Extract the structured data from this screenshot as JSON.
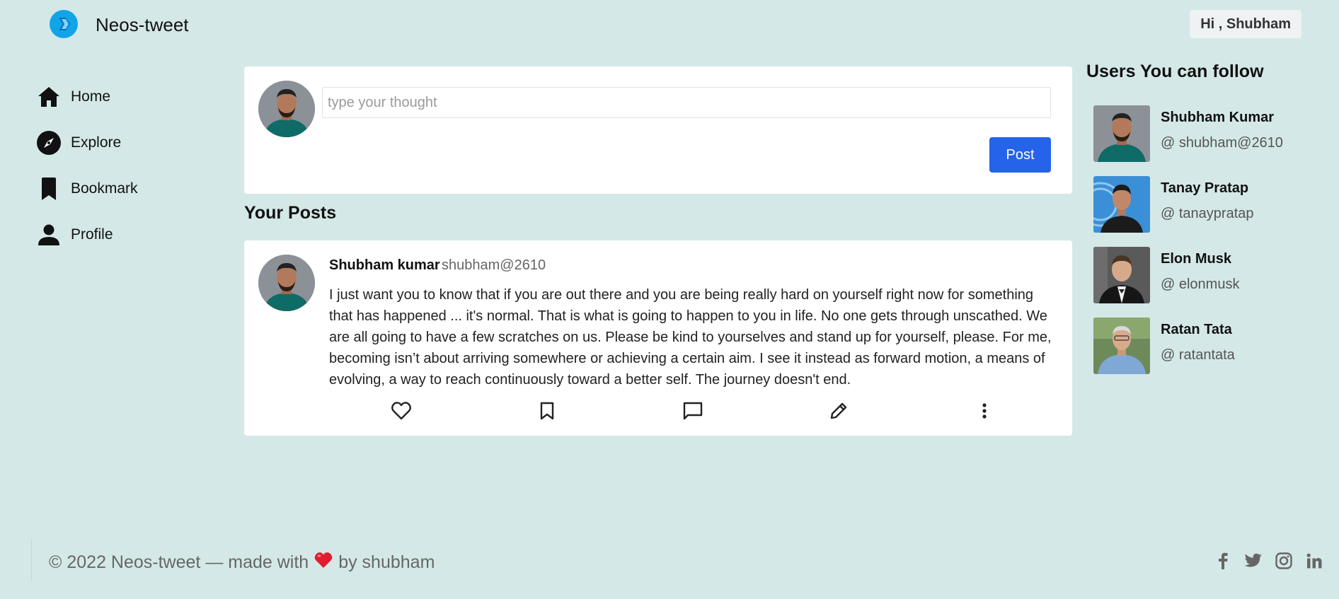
{
  "header": {
    "brand": "Neos-tweet",
    "greeting": "Hi , Shubham",
    "logo_icon": "arrow-chevron-logo-icon",
    "accent_color": "#11a4e8"
  },
  "sidebar": {
    "items": [
      {
        "label": "Home",
        "icon": "home-icon"
      },
      {
        "label": "Explore",
        "icon": "compass-icon"
      },
      {
        "label": "Bookmark",
        "icon": "bookmark-icon"
      },
      {
        "label": "Profile",
        "icon": "user-icon"
      }
    ]
  },
  "composer": {
    "placeholder": "type your thought",
    "value": "",
    "post_label": "Post",
    "post_color": "#2563eb"
  },
  "posts_section": {
    "title": "Your Posts",
    "posts": [
      {
        "name": "Shubham kumar",
        "handle": "shubham@2610",
        "body": "I just want you to know that if you are out there and you are being really hard on yourself right now for something that has happened ... it's normal. That is what is going to happen to you in life. No one gets through unscathed. We are all going to have a few scratches on us. Please be kind to yourselves and stand up for yourself, please. For me, becoming isn’t about arriving somewhere or achieving a certain aim. I see it instead as forward motion, a means of evolving, a way to reach continuously toward a better self. The journey doesn't end.",
        "actions": [
          "heart-icon",
          "bookmark-icon",
          "comment-icon",
          "edit-pencil-icon",
          "more-vertical-icon"
        ]
      }
    ]
  },
  "follow": {
    "title": "Users You can follow",
    "users": [
      {
        "name": "Shubham Kumar",
        "handle": "@ shubham@2610"
      },
      {
        "name": "Tanay Pratap",
        "handle": "@ tanaypratap"
      },
      {
        "name": "Elon Musk",
        "handle": "@ elonmusk"
      },
      {
        "name": "Ratan Tata",
        "handle": "@ ratantata"
      }
    ]
  },
  "footer": {
    "copyright_prefix": "© 2022 Neos-tweet — made with",
    "copyright_suffix": "by shubham",
    "heart_icon": "heart-emoji-icon",
    "socials": [
      "facebook-icon",
      "twitter-icon",
      "instagram-icon",
      "linkedin-icon"
    ]
  },
  "colors": {
    "background": "#d5e8e8",
    "card": "#ffffff",
    "heart": "#e11d2e"
  }
}
